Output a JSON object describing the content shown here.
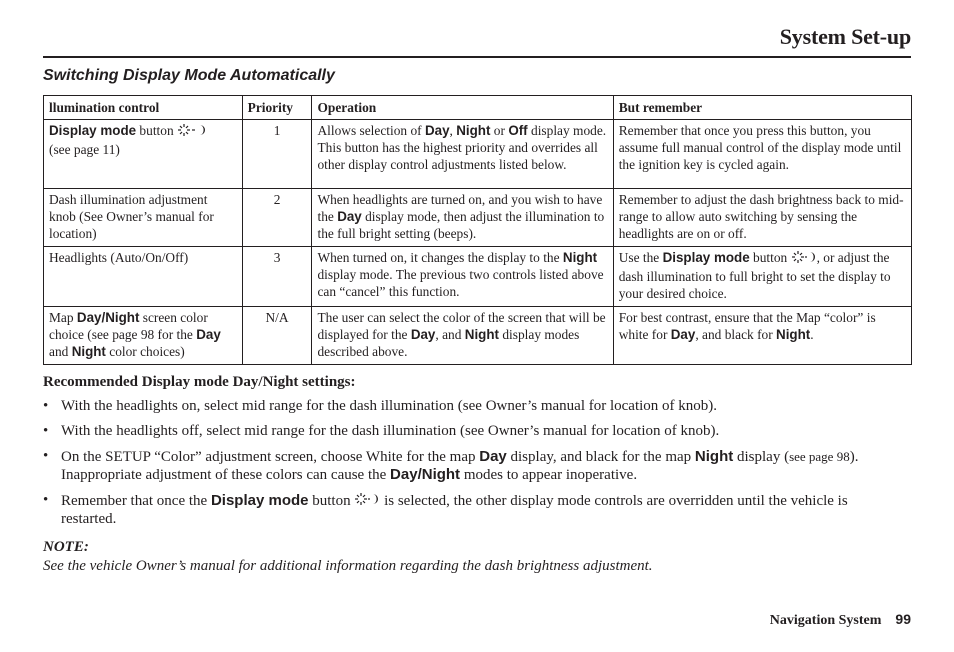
{
  "header": {
    "title": "System Set-up"
  },
  "section": {
    "heading": "Switching Display Mode Automatically"
  },
  "table": {
    "headers": [
      "llumination control",
      "Priority",
      "Operation",
      "But remember"
    ],
    "rows": [
      {
        "control_bold": "Display mode",
        "control_text": " button ",
        "control_ref": "(see page 11)",
        "priority": "1",
        "op_1": "Allows selection of ",
        "op_day": "Day",
        "op_2": ", ",
        "op_night": "Night",
        "op_3": " or ",
        "op_off": "Off",
        "op_4": " display mode.  This button has the highest priority and overrides all other display control adjustments listed below.",
        "remember": "Remember that once you press this button, you assume full manual control of the display mode until the ignition key is cycled again."
      },
      {
        "control": "Dash illumination adjustment knob (See Owner’s manual for location)",
        "priority": "2",
        "op_1": "When headlights are turned on, and you wish to have the ",
        "op_day": "Day",
        "op_2": " display mode, then adjust the illumination to the full bright setting (beeps).",
        "remember": "Remember to adjust the dash brightness back to mid-range to allow auto switching by sensing the headlights are on or off."
      },
      {
        "control": "Headlights (Auto/On/Off)",
        "priority": "3",
        "op_1": "When turned on, it changes the display to the ",
        "op_night": "Night",
        "op_2": " display mode.  The previous two controls listed above can “cancel” this function.",
        "rem_1": "Use the ",
        "rem_bold": "Display mode",
        "rem_2": " button ",
        "rem_3": ", or adjust the dash illumination to full bright to set the display to your desired choice."
      },
      {
        "ctrl_1": "Map ",
        "ctrl_daynight": "Day/Night",
        "ctrl_2": " screen color choice (see page 98 for the ",
        "ctrl_day": "Day",
        "ctrl_3": " and ",
        "ctrl_night": "Night",
        "ctrl_4": " color choices)",
        "priority": "N/A",
        "op_1": "The user can select the color of the screen that will be displayed for the ",
        "op_day": "Day",
        "op_2": ", and ",
        "op_night": "Night",
        "op_3": " display modes described above.",
        "rem_1": "For best contrast, ensure that the Map “color” is white for ",
        "rem_day": "Day",
        "rem_2": ", and black for ",
        "rem_night": "Night",
        "rem_3": "."
      }
    ]
  },
  "recommended": {
    "heading": "Recommended Display mode Day/Night settings:",
    "bullet_char": "•",
    "items": [
      {
        "text": "With the headlights on, select mid range for the dash illumination (see Owner’s manual for location of knob)."
      },
      {
        "text": "With the headlights off, select mid range for the dash illumination (see Owner’s manual for location of knob)."
      },
      {
        "t1": "On the SETUP “Color” adjustment screen, choose White for the map ",
        "day": "Day",
        "t2": " display, and black for the map ",
        "night": "Night",
        "t3": " display (",
        "see": "see page 98",
        "t4": "). Inappropriate adjustment of these colors can cause the ",
        "daynight": "Day/Night",
        "t5": " modes to appear inoperative."
      },
      {
        "t1": "Remember that once the ",
        "bold": "Display mode",
        "t2": " button ",
        "t3": " is selected, the other display mode controls are overridden until the vehicle is restarted."
      }
    ]
  },
  "note": {
    "label": "NOTE:",
    "text": "See the vehicle Owner’s manual for additional information regarding the dash brightness adjustment."
  },
  "footer": {
    "label": "Navigation System",
    "page": "99"
  },
  "icons": {
    "display_mode": "sun-moon-icon"
  }
}
